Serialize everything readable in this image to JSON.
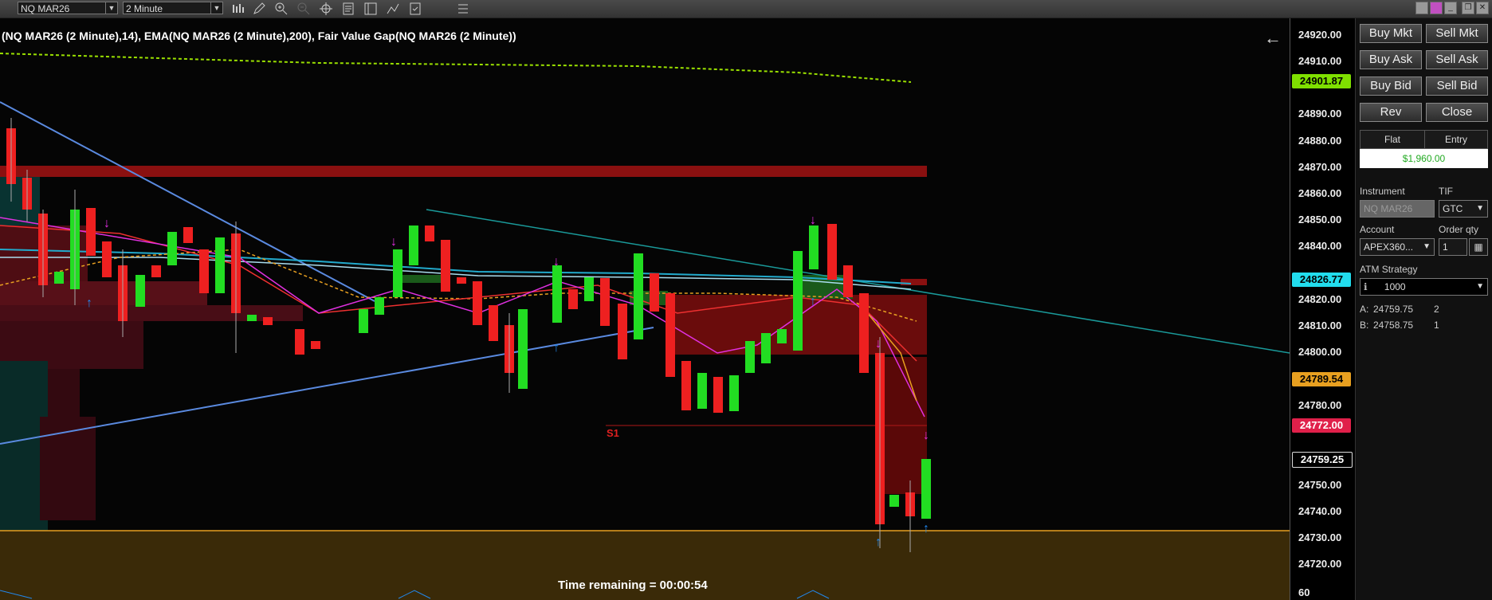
{
  "toolbar": {
    "instrument": "NQ MAR26",
    "interval": "2 Minute",
    "tools": [
      "bar-chart-icon",
      "pencil-icon",
      "zoom-in-icon",
      "zoom-out-icon",
      "crosshair-icon",
      "properties-icon",
      "data-box-icon",
      "draw-line-icon",
      "templates-icon",
      "list-icon"
    ]
  },
  "chart": {
    "title": "(NQ MAR26 (2 Minute),14), EMA(NQ MAR26 (2 Minute),200), Fair Value Gap(NQ MAR26 (2 Minute))",
    "time_remaining": "Time remaining = 00:00:54",
    "level_label": "S1",
    "indicator_value": "60"
  },
  "price_axis": {
    "ticks": [
      "24920.00",
      "24910.00",
      "24890.00",
      "24880.00",
      "24870.00",
      "24860.00",
      "24850.00",
      "24840.00",
      "24820.00",
      "24810.00",
      "24800.00",
      "24780.00",
      "24750.00",
      "24740.00",
      "24730.00",
      "24720.00"
    ],
    "tags": [
      {
        "value": "24901.87",
        "color": "#7fe000"
      },
      {
        "value": "24826.77",
        "color": "#22ddee"
      },
      {
        "value": "24789.54",
        "color": "#e8a020"
      },
      {
        "value": "24772.00",
        "color": "#e0204a"
      },
      {
        "value": "24759.25",
        "color": "#000000"
      }
    ]
  },
  "order_panel": {
    "buttons": [
      {
        "name": "buy-mkt-button",
        "label": "Buy Mkt"
      },
      {
        "name": "sell-mkt-button",
        "label": "Sell Mkt"
      },
      {
        "name": "buy-ask-button",
        "label": "Buy Ask"
      },
      {
        "name": "sell-ask-button",
        "label": "Sell Ask"
      },
      {
        "name": "buy-bid-button",
        "label": "Buy Bid"
      },
      {
        "name": "sell-bid-button",
        "label": "Sell Bid"
      },
      {
        "name": "rev-button",
        "label": "Rev"
      },
      {
        "name": "close-button",
        "label": "Close"
      }
    ],
    "position_label": "Flat",
    "entry_label": "Entry",
    "pnl": "$1,960.00",
    "instrument_label": "Instrument",
    "instrument_value": "NQ MAR26",
    "tif_label": "TIF",
    "tif_value": "GTC",
    "account_label": "Account",
    "account_value": "APEX360...",
    "order_qty_label": "Order qty",
    "order_qty_value": "1",
    "atm_label": "ATM Strategy",
    "atm_value": "1000",
    "ask_prefix": "A:",
    "ask_price": "24759.75",
    "ask_size": "2",
    "bid_prefix": "B:",
    "bid_price": "24758.75",
    "bid_size": "1"
  }
}
